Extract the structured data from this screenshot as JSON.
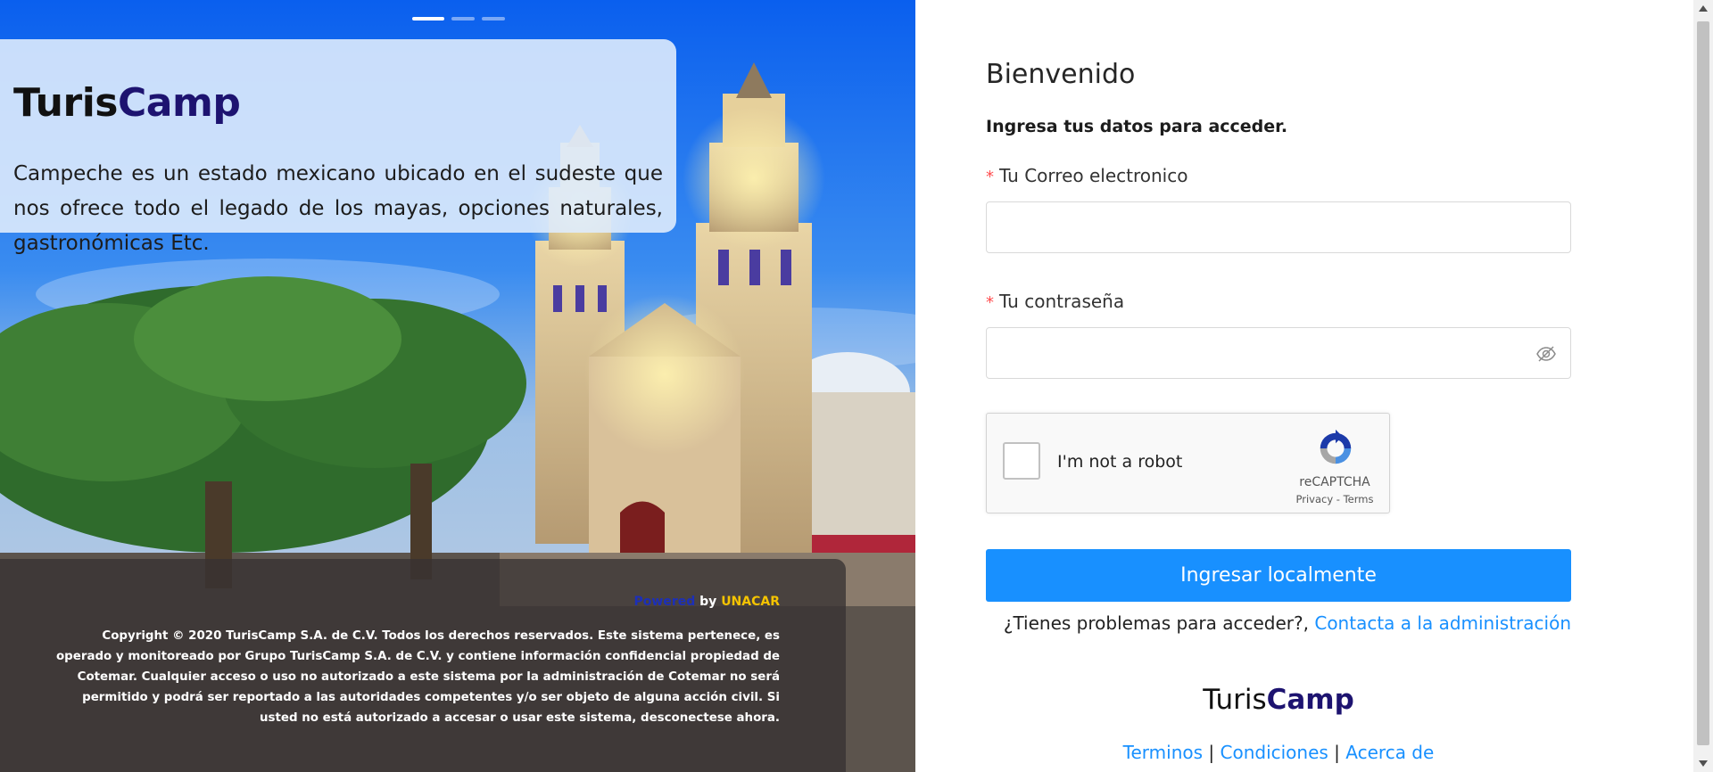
{
  "carousel": {
    "slides": 3,
    "active_index": 0
  },
  "hero": {
    "brand_part1": "Turis",
    "brand_part2": "Camp",
    "description": "Campeche es un estado mexicano ubicado en el sudeste que nos ofrece todo el legado de los mayas, opciones naturales, gastronómicas Etc."
  },
  "footer": {
    "powered": "Powered",
    "by": "by",
    "company": "UNACAR",
    "copyright": "Copyright © 2020 TurisCamp S.A. de C.V. Todos los derechos reservados. Este sistema pertenece, es operado y monitoreado por Grupo TurisCamp S.A. de C.V. y contiene información confidencial propiedad de Cotemar. Cualquier acceso o uso no autorizado a este sistema por la administración de Cotemar no será permitido y podrá ser reportado a las autoridades competentes y/o ser objeto de alguna acción civil. Si usted no está autorizado a accesar o usar este sistema, desconectese ahora."
  },
  "form": {
    "title": "Bienvenido",
    "subtitle": "Ingresa tus datos para acceder.",
    "required_mark": "*",
    "email_label": "Tu Correo electronico",
    "email_value": "",
    "password_label": "Tu contraseña",
    "password_value": "",
    "captcha": {
      "label": "I'm not a robot",
      "brand": "reCAPTCHA",
      "privacy": "Privacy",
      "separator": " - ",
      "terms": "Terms",
      "checked": false
    },
    "submit_label": "Ingresar localmente",
    "help_text": "¿Tienes problemas para acceder?, ",
    "help_link": "Contacta a la administración"
  },
  "bottom": {
    "brand_part1": "Turis",
    "brand_part2": "Camp",
    "separator": " | ",
    "terms": "Terminos",
    "conditions": "Condiciones",
    "about": "Acerca de"
  },
  "colors": {
    "primary": "#1890ff",
    "brand_dark": "#1d1370",
    "required": "#ff4d4f",
    "unacar": "#f5c400",
    "powered": "#1c2fb8"
  },
  "icons": [
    "eye-invisible-icon",
    "recaptcha-icon"
  ]
}
